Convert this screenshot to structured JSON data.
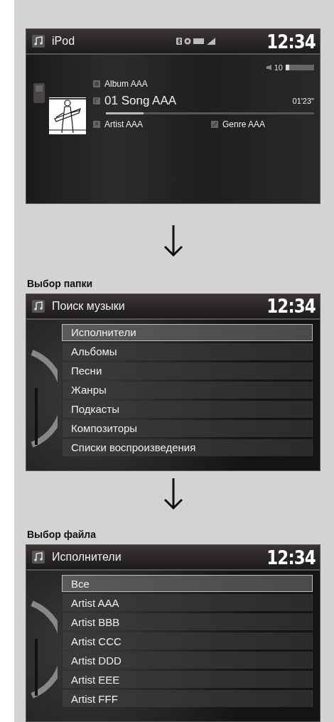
{
  "screens": [
    {
      "kind": "now_playing",
      "title": "iPod",
      "clock": "12:34",
      "volume": {
        "reading": "10",
        "level": 0.12
      },
      "album": "Album AAA",
      "track": "01 Song AAA",
      "elapsed": "01'23\"",
      "progress": {
        "level": 0.18
      },
      "artist": "Artist AAA",
      "genre": "Genre AAA"
    },
    {
      "kind": "list",
      "caption": "Выбор папки",
      "title": "Поиск музыки",
      "clock": "12:34",
      "items": [
        {
          "label": "Исполнители",
          "selected": true
        },
        {
          "label": "Альбомы",
          "selected": false
        },
        {
          "label": "Песни",
          "selected": false
        },
        {
          "label": "Жанры",
          "selected": false
        },
        {
          "label": "Подкасты",
          "selected": false
        },
        {
          "label": "Композиторы",
          "selected": false
        },
        {
          "label": "Списки воспроизведения",
          "selected": false
        }
      ]
    },
    {
      "kind": "list",
      "caption": "Выбор файла",
      "title": "Исполнители",
      "clock": "12:34",
      "items": [
        {
          "label": "Все",
          "selected": true
        },
        {
          "label": "Artist AAA",
          "selected": false
        },
        {
          "label": "Artist BBB",
          "selected": false
        },
        {
          "label": "Artist CCC",
          "selected": false
        },
        {
          "label": "Artist DDD",
          "selected": false
        },
        {
          "label": "Artist EEE",
          "selected": false
        },
        {
          "label": "Artist FFF",
          "selected": false
        }
      ]
    }
  ]
}
